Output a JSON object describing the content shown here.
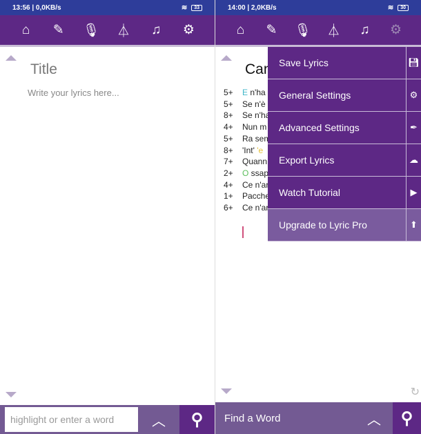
{
  "left": {
    "status": {
      "time": "13:56 | 0,0KB/s",
      "battery": "33"
    },
    "toolbar": [
      "home-icon",
      "edit-icon",
      "microphone-icon",
      "metronome-icon",
      "music-note-icon",
      "gear-icon"
    ],
    "title_placeholder": "Title",
    "lyrics_placeholder": "Write your lyrics here...",
    "search_placeholder": "highlight or enter a word"
  },
  "right": {
    "status": {
      "time": "14:00 | 2,0KB/s",
      "battery": "30"
    },
    "song_title": "Can",
    "lines": [
      {
        "n": "5+",
        "hl": "E",
        "hl_color": "#3fb6c8",
        "text": " n'ha"
      },
      {
        "n": "5+",
        "text": "Se n'è"
      },
      {
        "n": "8+",
        "text": "Se n'ha"
      },
      {
        "n": "4+",
        "text": "Nun m"
      },
      {
        "n": "5+",
        "text": "Ra sem"
      },
      {
        "n": "8+",
        "pre": "'Int' ",
        "hl": "'e",
        "hl_color": "#e6c23a",
        "text": ""
      },
      {
        "n": "7+",
        "text": "Quann"
      },
      {
        "n": "2+",
        "hl": "O",
        "hl_color": "#5cbf5c",
        "text": " ssap"
      },
      {
        "n": "4+",
        "text": "Ce n'ar"
      },
      {
        "n": "1+",
        "text": "Pacche"
      },
      {
        "n": "6+",
        "text": "Ce n'ar"
      }
    ],
    "menu": [
      {
        "label": "Save Lyrics",
        "icon": "save-icon"
      },
      {
        "label": "General Settings",
        "icon": "gears-icon"
      },
      {
        "label": "Advanced Settings",
        "icon": "pen-nib-icon"
      },
      {
        "label": "Export Lyrics",
        "icon": "cloud-upload-icon"
      },
      {
        "label": "Watch Tutorial",
        "icon": "youtube-icon"
      },
      {
        "label": "Upgrade to Lyric Pro",
        "icon": "arrow-up-circle-icon"
      }
    ],
    "find_label": "Find a Word"
  }
}
